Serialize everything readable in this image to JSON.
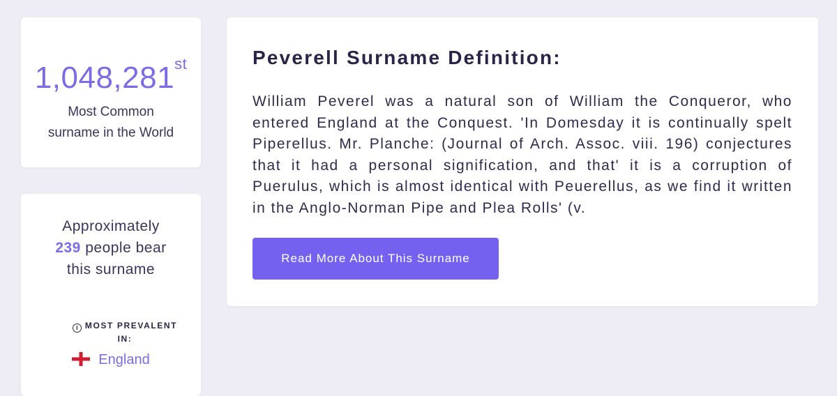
{
  "rank": {
    "number": "1,048,281",
    "suffix": "st",
    "caption": "Most Common surname in the World"
  },
  "population": {
    "prefix": "Approximately",
    "count": "239",
    "suffix": "people bear this surname",
    "prevalent_label": "MOST PREVALENT IN:",
    "country": "England",
    "country_flag_icon": "england-flag-icon"
  },
  "definition": {
    "title": "Peverell Surname Definition:",
    "body": "William Peverel was a natural son of William the Conqueror, who entered England at the Conquest. 'In Domesday it is continually spelt Piperellus. Mr. Planche: (Journal of Arch. Assoc. viii. 196) conjectures that it had a personal signification, and that' it is a corruption of Puerulus, which is almost identical with Peuerellus, as we find it written in the Anglo-Norman Pipe and Plea Rolls' (v.",
    "button_label": "Read More About This Surname"
  },
  "colors": {
    "accent": "#7461ef",
    "accent_text": "#7b6ce6",
    "background": "#eeedf6",
    "card": "#ffffff",
    "text": "#2a2548"
  }
}
